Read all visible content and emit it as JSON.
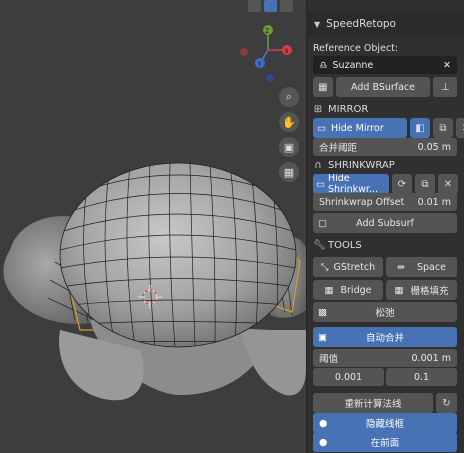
{
  "panel": {
    "title": "SpeedRetopo",
    "reference_label": "Reference Object:",
    "reference_value": "Suzanne",
    "add_bsurface": "Add BSurface",
    "mirror_header": "MIRROR",
    "hide_mirror": "Hide Mirror",
    "merge_threshold_label": "合并阈距",
    "merge_threshold_value": "0.05 m",
    "shrinkwrap_header": "SHRINKWRAP",
    "hide_shrinkwrap": "Hide Shrinkwr...",
    "shrinkwrap_offset_label": "Shrinkwrap Offset",
    "shrinkwrap_offset_value": "0.01 m",
    "add_subsurf": "Add Subsurf",
    "tools_header": "TOOLS",
    "gstretch": "GStretch",
    "space": "Space",
    "bridge": "Bridge",
    "grid_fill": "栅格填充",
    "relax": "松弛",
    "auto_merge": "自动合并",
    "threshold_label": "阈值",
    "threshold_value": "0.001 m",
    "value_a": "0.001",
    "value_b": "0.1",
    "recalc_normals": "重新计算法线",
    "hide_wireframe": "隐藏线框",
    "in_front": "在前面"
  },
  "gizmo": {
    "x": "X",
    "y": "Y",
    "z": "Z"
  },
  "colors": {
    "accent": "#4772b3",
    "panel_bg": "#303030",
    "field_bg": "#545454",
    "viewport_bg": "#3d3d3d"
  },
  "icons": {
    "zoom": "magnifier-icon",
    "pan": "hand-icon",
    "camera": "camera-icon",
    "grid": "grid-view-icon"
  }
}
